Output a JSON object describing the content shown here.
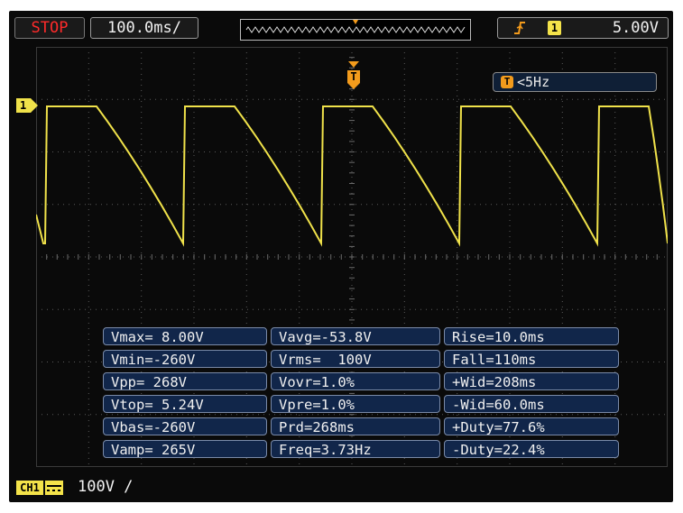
{
  "topbar": {
    "run_state": "STOP",
    "timebase": "100.0ms/",
    "trigger": {
      "edge_icon": "rising-edge-icon",
      "source": "1",
      "level": "5.00V"
    }
  },
  "screen": {
    "channel_marker": "1",
    "trigger_marker": "T",
    "freq_counter": {
      "badge": "T",
      "value": "<5Hz"
    }
  },
  "measurements": {
    "rows": [
      [
        "Vmax= 8.00V",
        "Vavg=-53.8V",
        "Rise=10.0ms"
      ],
      [
        "Vmin=-260V",
        "Vrms=  100V",
        "Fall=110ms"
      ],
      [
        "Vpp= 268V",
        "Vovr=1.0%",
        "+Wid=208ms"
      ],
      [
        "Vtop= 5.24V",
        "Vpre=1.0%",
        "-Wid=60.0ms"
      ],
      [
        "Vbas=-260V",
        "Prd=268ms",
        "+Duty=77.6%"
      ],
      [
        "Vamp= 265V",
        "Freq=3.73Hz",
        "-Duty=22.4%"
      ]
    ]
  },
  "bottombar": {
    "channel_label": "CH1",
    "coupling_icon": "dc-coupling-icon",
    "scale": "100V /"
  },
  "colors": {
    "trace": "#f0e24a",
    "stop": "#ff2a2a",
    "trigger": "#f39b1c",
    "measure_bg": "#11264a",
    "grid": "#5a5a5a"
  }
}
